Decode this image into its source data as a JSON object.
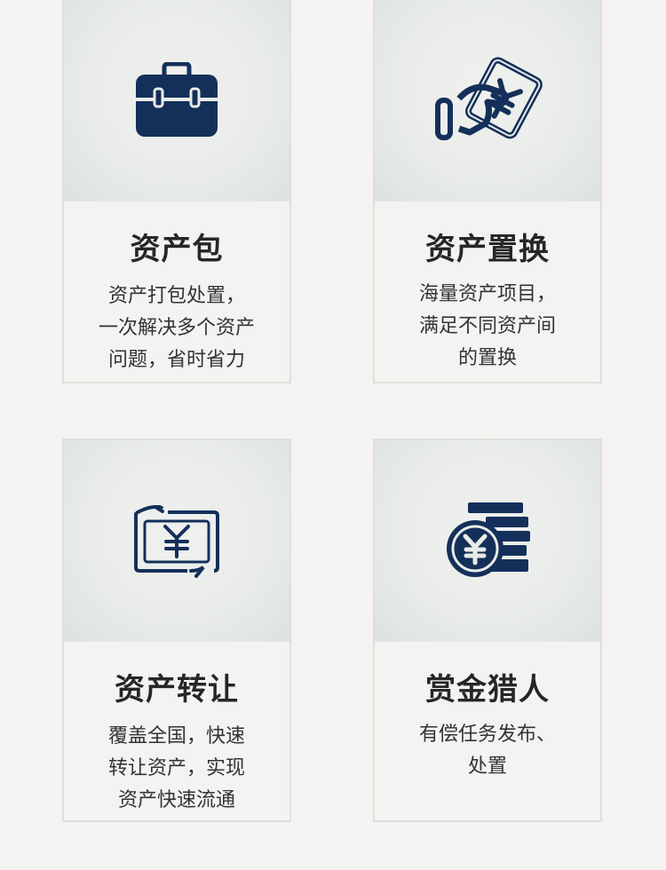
{
  "cards": [
    {
      "title": "资产包",
      "icon": "briefcase-icon",
      "desc": [
        "资产打包处置，",
        "一次解决多个资产",
        "问题，省时省力"
      ]
    },
    {
      "title": "资产置换",
      "icon": "hand-yuan-card-icon",
      "desc": [
        "海量资产项目，",
        "满足不同资产间",
        "的置换"
      ]
    },
    {
      "title": "资产转让",
      "icon": "yuan-transfer-icon",
      "desc": [
        "覆盖全国，快速",
        "转让资产，实现",
        "资产快速流通"
      ]
    },
    {
      "title": "赏金猎人",
      "icon": "yuan-coin-stack-icon",
      "desc": [
        "有偿任务发布、",
        "处置"
      ]
    }
  ],
  "colors": {
    "icon": "#14305a",
    "background": "#f4f3f1",
    "border": "#e0dfdc"
  }
}
